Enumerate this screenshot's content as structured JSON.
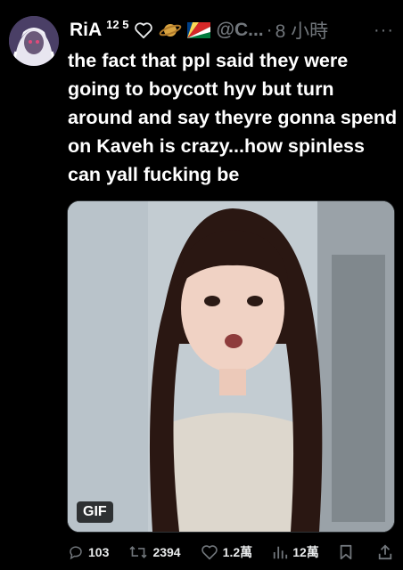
{
  "tweet": {
    "display_name": "RiA",
    "superscript": "12 5",
    "handle": "@C...",
    "time_separator": "·",
    "time_ago": "8 小時",
    "more_label": "···",
    "text": "the fact that ppl said they were going to boycott hyv but turn around and say theyre gonna spend on Kaveh is crazy...how spinless can yall fucking be"
  },
  "media": {
    "badge": "GIF"
  },
  "actions": {
    "replies": "103",
    "retweets": "2394",
    "likes": "1.2萬",
    "views": "12萬"
  },
  "icons": {
    "header": [
      "heart-outline-icon",
      "ringed-planet-icon",
      "seychelles-flag-icon"
    ],
    "actions": [
      "reply-icon",
      "retweet-icon",
      "like-icon",
      "views-icon",
      "bookmark-icon",
      "share-icon"
    ]
  }
}
